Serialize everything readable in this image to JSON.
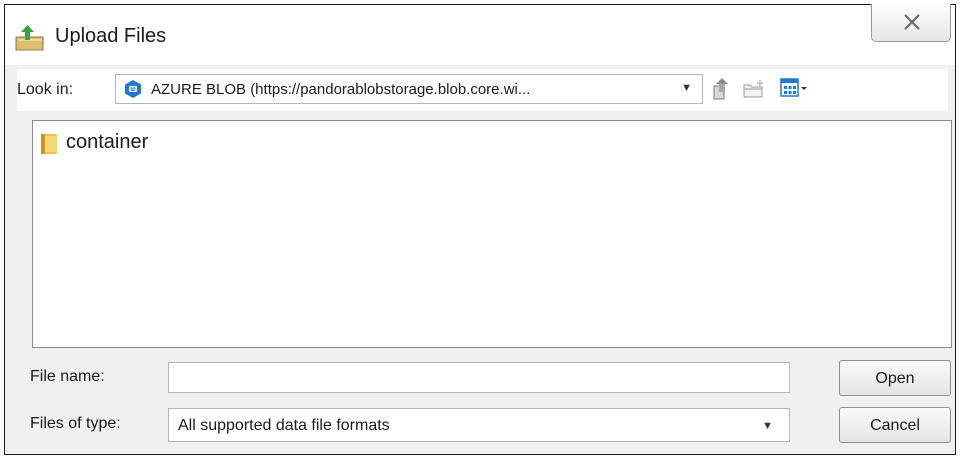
{
  "window": {
    "title": "Upload Files",
    "title_icon": "upload-icon",
    "close_icon": "close-icon"
  },
  "lookin": {
    "label": "Look in:",
    "value": "AZURE BLOB (https://pandorablobstorage.blob.core.wi...",
    "value_icon": "azure-blob-icon",
    "toolbar": [
      "up-one-level-icon",
      "create-new-folder-icon",
      "view-menu-icon"
    ]
  },
  "files": [
    {
      "name": "container",
      "icon": "folder-icon"
    }
  ],
  "filename": {
    "label": "File name:",
    "value": "",
    "placeholder": ""
  },
  "filetype": {
    "label": "Files of type:",
    "value": "All supported data file formats"
  },
  "buttons": {
    "open": "Open",
    "cancel": "Cancel"
  },
  "colors": {
    "dialog_bg": "#f0f0f0",
    "field_border": "#b5b5b5",
    "azure_blue": "#1e78d4",
    "folder_yellow": "#e8c04a"
  }
}
